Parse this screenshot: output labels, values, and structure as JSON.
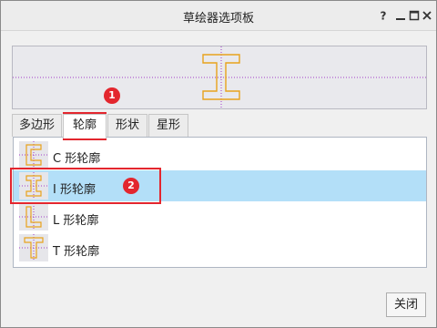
{
  "window": {
    "title": "草绘器选项板"
  },
  "tabs": [
    {
      "label": "多边形"
    },
    {
      "label": "轮廓"
    },
    {
      "label": "形状"
    },
    {
      "label": "星形"
    }
  ],
  "active_tab": "轮廓",
  "list": {
    "items": [
      {
        "label": "C 形轮廓",
        "icon": "c-profile-icon"
      },
      {
        "label": "I 形轮廓",
        "icon": "i-profile-icon"
      },
      {
        "label": "L 形轮廓",
        "icon": "l-profile-icon"
      },
      {
        "label": "T 形轮廓",
        "icon": "t-profile-icon"
      }
    ],
    "selected": "I 形轮廓"
  },
  "annotations": {
    "badge_1": "1",
    "badge_2": "2"
  },
  "footer": {
    "close_label": "关闭"
  },
  "colors": {
    "profile_stroke": "#e8a21c",
    "centerline": "#a23cc8",
    "selection": "#b3dff8",
    "callout": "#e3262e"
  }
}
